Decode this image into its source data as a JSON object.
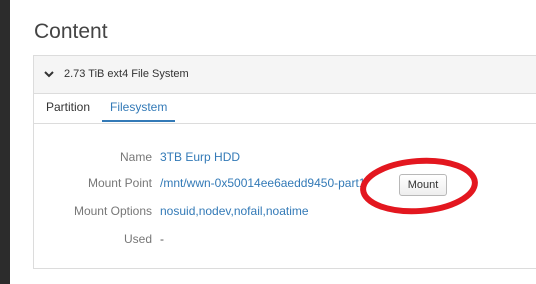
{
  "page": {
    "title": "Content"
  },
  "panel": {
    "title": "2.73 TiB ext4 File System",
    "chevron_icon": "chevron-down-icon"
  },
  "tabs": [
    {
      "label": "Partition",
      "active": false
    },
    {
      "label": "Filesystem",
      "active": true
    }
  ],
  "filesystem": {
    "rows": [
      {
        "label": "Name",
        "value": "3TB Eurp HDD"
      },
      {
        "label": "Mount Point",
        "value": "/mnt/wwn-0x50014ee6aedd9450-part1"
      },
      {
        "label": "Mount Options",
        "value": "nosuid,nodev,nofail,noatime"
      },
      {
        "label": "Used",
        "value": "-"
      }
    ],
    "mount_button_label": "Mount"
  },
  "colors": {
    "link": "#337ab7",
    "annotation_circle": "#e3171f",
    "left_bar": "#2c2c2c"
  }
}
